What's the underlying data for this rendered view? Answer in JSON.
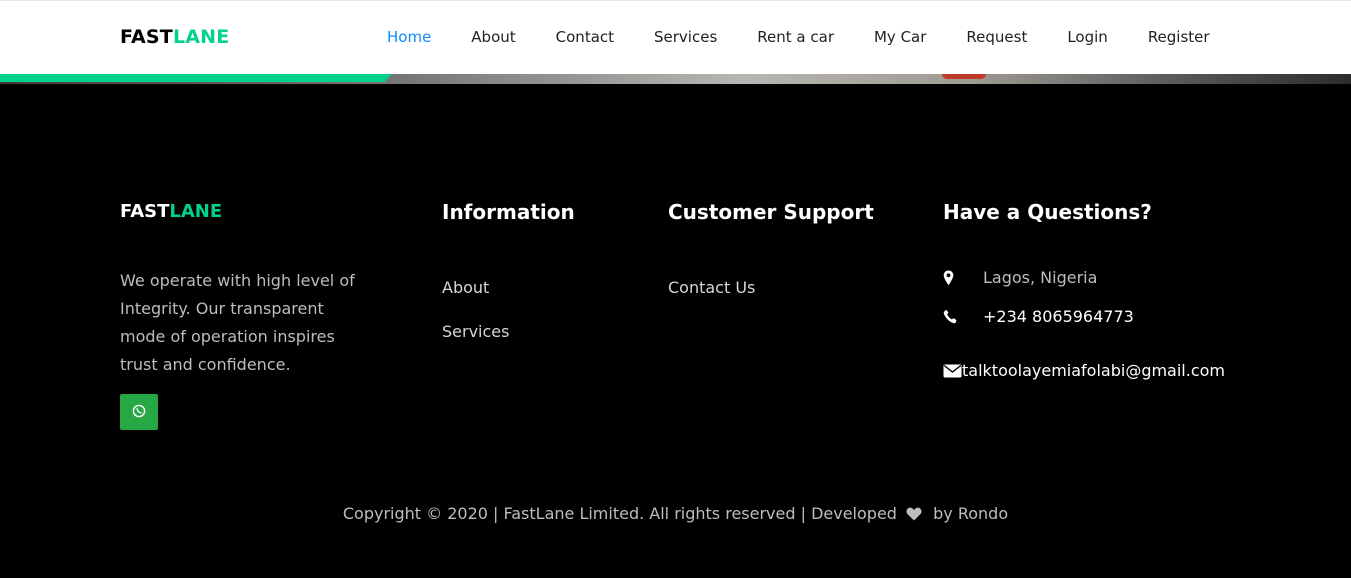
{
  "navbar": {
    "brand_part1": "FAST",
    "brand_part2": "LANE",
    "links": [
      "Home",
      "About",
      "Contact",
      "Services",
      "Rent a car",
      "My Car",
      "Request",
      "Login",
      "Register"
    ],
    "active": "Home",
    "active_color": "#1089ff"
  },
  "footer": {
    "brand_part1": "FAST",
    "brand_part2": "LANE",
    "about_text": "We operate with high level of Integrity. Our transparent mode of operation inspires trust and confidence.",
    "social_icon": "whatsapp-icon",
    "information": {
      "title": "Information",
      "links": [
        "About",
        "Services"
      ]
    },
    "support": {
      "title": "Customer Support",
      "links": [
        "Contact Us"
      ]
    },
    "questions": {
      "title": "Have a Questions?",
      "location": "Lagos, Nigeria",
      "phone": "+234 8065964773",
      "email": "talktoolayemiafolabi@gmail.com"
    },
    "copyright_before": "Copyright © 2020 | FastLane Limited. All rights reserved | Developed",
    "copyright_after": "by Rondo"
  },
  "colors": {
    "accent": "#01d28e",
    "whatsapp": "#28a745",
    "background": "#000000"
  }
}
